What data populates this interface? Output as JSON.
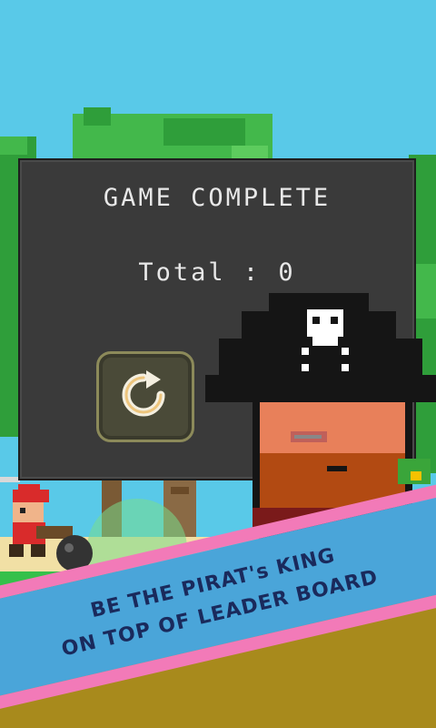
{
  "panel": {
    "title": "GAME COMPLETE",
    "total_label": "Total : 0"
  },
  "restart_button": {
    "icon": "restart-icon"
  },
  "banner": {
    "line1": "BE THE PIRAT's KING",
    "line2": "ON TOP OF LEADER BOARD"
  },
  "colors": {
    "sky": "#59c9e8",
    "panel_bg": "#3a3a3a",
    "banner_blue": "#4aa5d9",
    "banner_pink": "#f27ab8",
    "grass": "#35c04a",
    "dirt": "#a88a1c"
  }
}
